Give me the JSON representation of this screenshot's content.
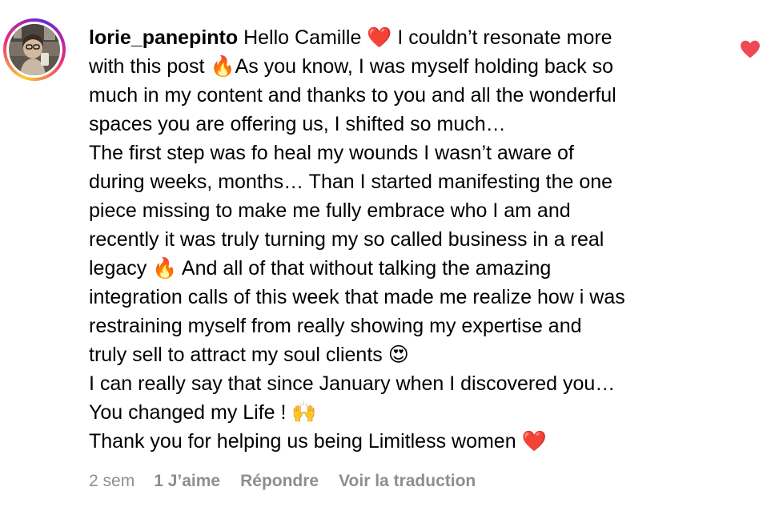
{
  "comment": {
    "username": "lorie_panepinto",
    "lines": [
      "Hello Camille ❤️ I couldn’t resonate more",
      "with this post 🔥As you know, I was myself holding back so",
      "much in my content and thanks to you and all the wonderful",
      "spaces you are offering us, I shifted so much…",
      "The first step was fo heal my wounds I wasn’t aware of",
      "during weeks, months… Than I started manifesting the one",
      "piece missing to make me fully embrace who I am and",
      "recently it was truly turning my so called business in a real",
      "legacy 🔥 And all of that without talking the amazing",
      "integration calls of this week that made me realize how i was",
      "restraining myself from really showing my expertise and",
      "truly sell to attract my soul clients 😍",
      "I can really say that since January when I discovered you…",
      "You changed my Life ! 🙌",
      "Thank you for helping us being Limitless women ❤️"
    ],
    "time": "2 sem",
    "likes_label": "1 J’aime",
    "reply_label": "Répondre",
    "translate_label": "Voir la traduction",
    "like_icon": "heart-icon",
    "liked": true,
    "like_color": "#ed4956",
    "meta_color": "#8e8e8e"
  }
}
